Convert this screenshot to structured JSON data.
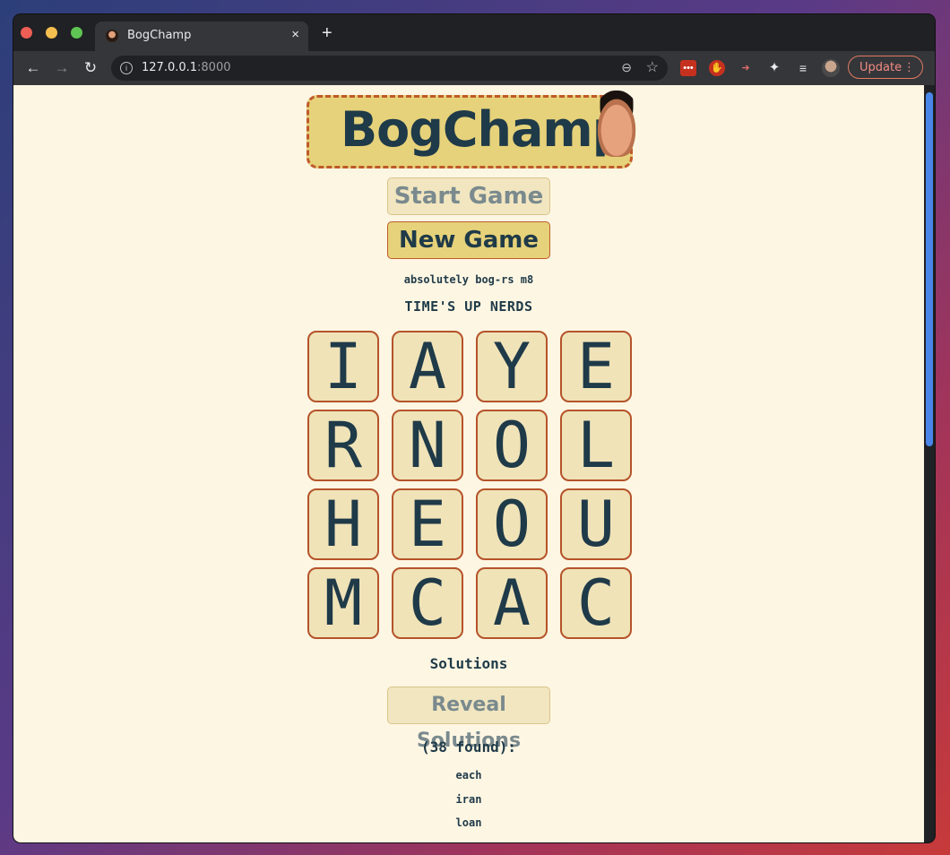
{
  "browser": {
    "tab_title": "BogChamp",
    "tab_close": "×",
    "new_tab": "+",
    "url_host": "127.0.0.1",
    "url_port": ":8000",
    "update_label": "Update",
    "update_menu": "⋮",
    "icons": {
      "back": "←",
      "forward": "→",
      "reload": "↻",
      "info": "i",
      "zoom": "⊖",
      "star": "☆",
      "puzzle": "✦",
      "media": "≡"
    }
  },
  "app": {
    "logo_text": "BogChamp",
    "start_game_label": "Start Game",
    "new_game_label": "New Game",
    "subtitle": "absolutely bog-rs m8",
    "timer_text": "TIME'S UP NERDS",
    "board": [
      [
        "I",
        "A",
        "Y",
        "E"
      ],
      [
        "R",
        "N",
        "O",
        "L"
      ],
      [
        "H",
        "E",
        "O",
        "U"
      ],
      [
        "M",
        "C",
        "A",
        "C"
      ]
    ],
    "solutions_heading": "Solutions",
    "reveal_label": "Reveal Solutions",
    "found_count": "(38 found):",
    "words": [
      "each",
      "iran",
      "loan"
    ]
  },
  "colors": {
    "page_bg": "#fdf6e3",
    "accent_gold": "#e6d27a",
    "accent_rust": "#bf5a2a",
    "text_dark": "#1f3a48"
  }
}
